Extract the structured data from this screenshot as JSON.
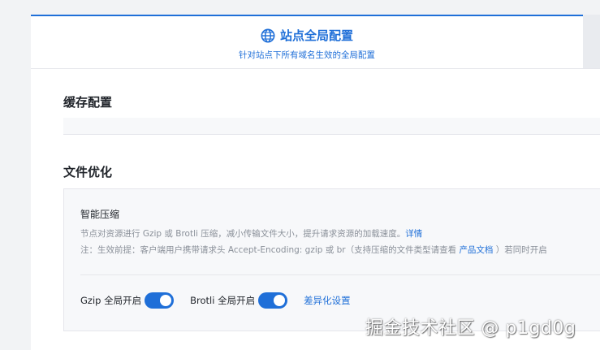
{
  "tab": {
    "title": "站点全局配置",
    "subtitle": "针对站点下所有域名生效的全局配置",
    "icon": "globe-icon"
  },
  "sections": {
    "cache": {
      "title": "缓存配置"
    },
    "file": {
      "title": "文件优化"
    }
  },
  "compression": {
    "title": "智能压缩",
    "desc_main": "节点对资源进行 Gzip 或 Brotli 压缩，减小传输文件大小，提升请求资源的加载速度。",
    "desc_link": "详情",
    "note_prefix": "注：生效前提：客户端用户携带请求头 Accept-Encoding: gzip 或 br（支持压缩的文件类型请查看",
    "note_link": "产品文档",
    "note_suffix": "）若同时开启",
    "gzip_label": "Gzip 全局开启",
    "gzip_on": true,
    "brotli_label": "Brotli 全局开启",
    "brotli_on": true,
    "diff_link": "差异化设置"
  },
  "watermark": "掘金技术社区 @ p1gd0g",
  "colors": {
    "accent": "#1f6fd8",
    "page_bg": "#f2f3f5",
    "card_bg": "#f7f8fa"
  }
}
